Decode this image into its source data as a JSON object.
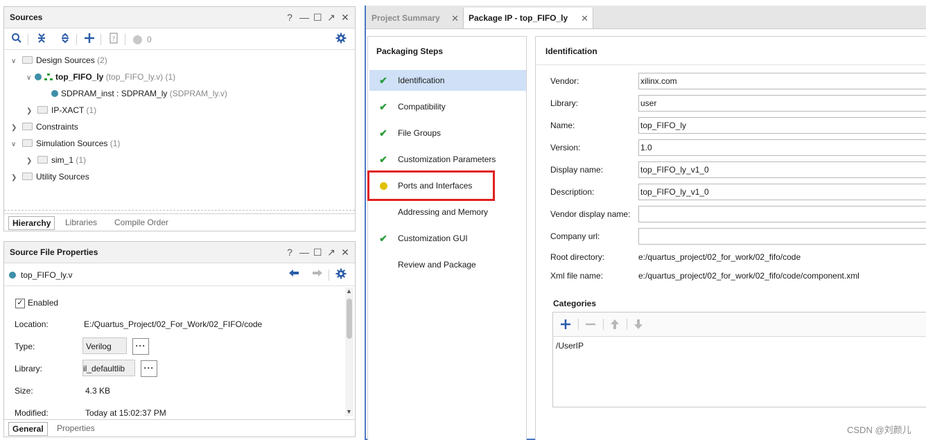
{
  "sources_panel": {
    "title": "Sources",
    "window_buttons": [
      "?",
      "—",
      "☐",
      "↗",
      "✕"
    ],
    "toolbar": {
      "counter": "0"
    },
    "tree": [
      {
        "label": "Design Sources",
        "count": "(2)"
      },
      {
        "label": "top_FIFO_ly",
        "file": "(top_FIFO_ly.v)",
        "count": "(1)"
      },
      {
        "label": "SDPRAM_inst : SDPRAM_ly",
        "file": "(SDPRAM_ly.v)"
      },
      {
        "label": "IP-XACT",
        "count": "(1)"
      },
      {
        "label": "Constraints"
      },
      {
        "label": "Simulation Sources",
        "count": "(1)"
      },
      {
        "label": "sim_1",
        "count": "(1)"
      },
      {
        "label": "Utility Sources"
      }
    ],
    "tabs": [
      "Hierarchy",
      "Libraries",
      "Compile Order"
    ]
  },
  "file_properties_panel": {
    "title": "Source File Properties",
    "window_buttons": [
      "?",
      "—",
      "☐",
      "↗",
      "✕"
    ],
    "file_name": "top_FIFO_ly.v",
    "enabled_label": "Enabled",
    "properties": {
      "location_label": "Location:",
      "location_value": "E:/Quartus_Project/02_For_Work/02_FIFO/code",
      "type_label": "Type:",
      "type_value": "Verilog",
      "library_label": "Library:",
      "library_value": "xil_defaultlib",
      "size_label": "Size:",
      "size_value": "4.3 KB",
      "modified_label": "Modified:",
      "modified_value": "Today at 15:02:37 PM"
    },
    "dots_label": "···",
    "tabs": [
      "General",
      "Properties"
    ]
  },
  "editor_tabs": [
    {
      "label": "Project Summary",
      "active": false
    },
    {
      "label": "Package IP - top_FIFO_ly",
      "active": true
    }
  ],
  "packaging_steps": {
    "title": "Packaging Steps",
    "steps": [
      {
        "label": "Identification",
        "status": "done"
      },
      {
        "label": "Compatibility",
        "status": "done"
      },
      {
        "label": "File Groups",
        "status": "done"
      },
      {
        "label": "Customization Parameters",
        "status": "done"
      },
      {
        "label": "Ports and Interfaces",
        "status": "warning"
      },
      {
        "label": "Addressing and Memory",
        "status": "none"
      },
      {
        "label": "Customization GUI",
        "status": "done"
      },
      {
        "label": "Review and Package",
        "status": "none"
      }
    ]
  },
  "identification": {
    "title": "Identification",
    "fields": [
      {
        "label": "Vendor:",
        "value": "xilinx.com"
      },
      {
        "label": "Library:",
        "value": "user"
      },
      {
        "label": "Name:",
        "value": "top_FIFO_ly"
      },
      {
        "label": "Version:",
        "value": "1.0"
      },
      {
        "label": "Display name:",
        "value": "top_FIFO_ly_v1_0"
      },
      {
        "label": "Description:",
        "value": "top_FIFO_ly_v1_0"
      },
      {
        "label": "Vendor display name:",
        "value": ""
      },
      {
        "label": "Company url:",
        "value": ""
      }
    ],
    "root_directory_label": "Root directory:",
    "root_directory_value": "e:/quartus_project/02_for_work/02_fifo/code",
    "xml_file_label": "Xml file name:",
    "xml_file_value": "e:/quartus_project/02_for_work/02_fifo/code/component.xml",
    "categories_title": "Categories",
    "categories": [
      "/UserIP"
    ]
  },
  "watermark": "CSDN @刘颜儿",
  "colors": {
    "accent": "#2a5ba8",
    "selection": "#cfe0f7",
    "highlight_box": "#e02020",
    "check": "#2a9d3a",
    "warning": "#e0c000"
  }
}
